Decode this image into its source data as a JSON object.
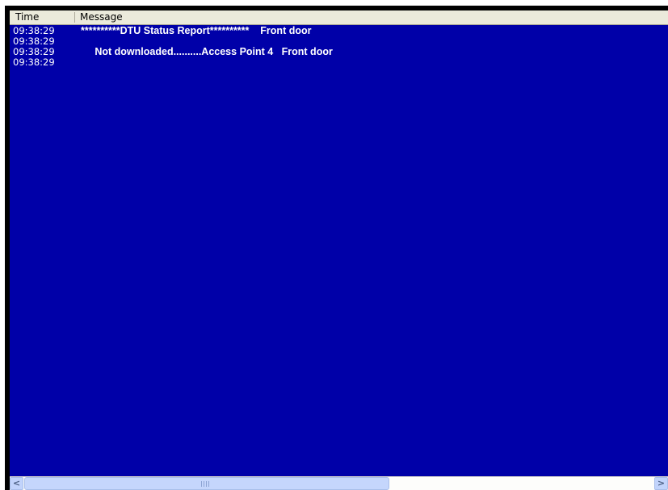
{
  "list": {
    "columns": [
      {
        "label": "Time"
      },
      {
        "label": "Message"
      }
    ],
    "rows": [
      {
        "time": "09:38:29",
        "message": "**********DTU Status Report**********    Front door"
      },
      {
        "time": "09:38:29",
        "message": ""
      },
      {
        "time": "09:38:29",
        "message": "     Not downloaded..........Access Point 4   Front door"
      },
      {
        "time": "09:38:29",
        "message": ""
      }
    ]
  },
  "scrollbar": {
    "left_arrow": "<",
    "right_arrow": ">"
  },
  "colors": {
    "list_background": "#0000a8",
    "text": "#ffffff",
    "header_background": "#ebeadb"
  }
}
